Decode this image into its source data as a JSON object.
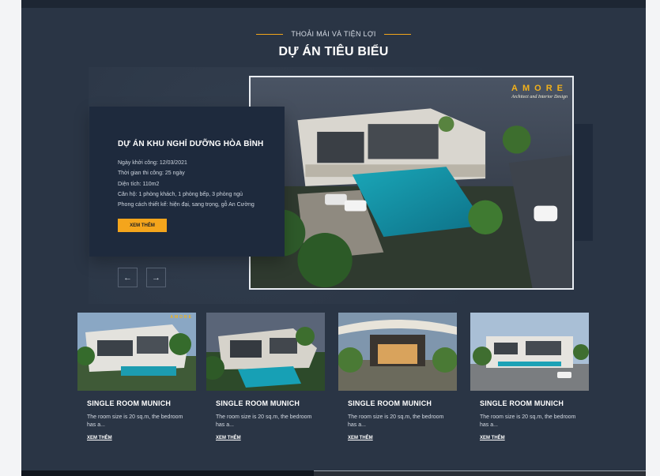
{
  "section": {
    "eyebrow": "THOẢI MÁI VÀ TIỆN LỢI",
    "title": "DỰ ÁN TIÊU BIỂU"
  },
  "featured_project": {
    "title": "DỰ ÁN KHU NGHỈ DƯỠNG HÒA BÌNH",
    "details": [
      "Ngày khởi công: 12/03/2021",
      "Thời gian thi công: 25 ngày",
      "Diện tích: 110m2",
      "Căn hộ: 1 phòng khách, 1 phòng bếp, 3 phòng ngủ",
      "Phong cách thiết kế: hiện đại, sang trọng, gỗ An Cường"
    ],
    "button_label": "XEM THÊM"
  },
  "hero_image": {
    "brand_name": "AMORE",
    "brand_tagline": "Architect and Interior Design",
    "accent_color": "#f2b11a"
  },
  "carousel": {
    "prev_icon": "arrow-left-icon",
    "next_icon": "arrow-right-icon",
    "prev_glyph": "←",
    "next_glyph": "→"
  },
  "projects": [
    {
      "title": "SINGLE ROOM MUNICH",
      "description": "The room size is 20 sq.m, the bedroom has a...",
      "link": "XEM THÊM"
    },
    {
      "title": "SINGLE ROOM MUNICH",
      "description": "The room size is 20 sq.m, the bedroom has a...",
      "link": "XEM THÊM"
    },
    {
      "title": "SINGLE ROOM MUNICH",
      "description": "The room size is 20 sq.m, the bedroom has a...",
      "link": "XEM THÊM"
    },
    {
      "title": "SINGLE ROOM MUNICH",
      "description": "The room size is 20 sq.m, the bedroom has a...",
      "link": "XEM THÊM"
    }
  ],
  "colors": {
    "background": "#2a3545",
    "card": "#1e2a3d",
    "accent": "#f4a51c"
  }
}
